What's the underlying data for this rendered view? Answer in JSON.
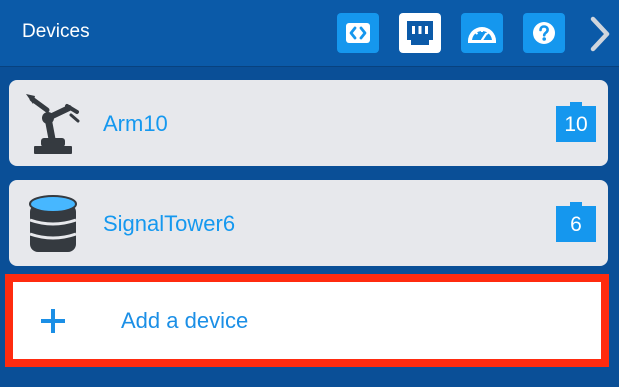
{
  "header": {
    "title": "Devices",
    "buttons": [
      {
        "name": "code-view-button",
        "icon": "code-icon"
      },
      {
        "name": "network-port-button",
        "icon": "ethernet-port-icon"
      },
      {
        "name": "dashboard-button",
        "icon": "speedometer-icon"
      },
      {
        "name": "help-button",
        "icon": "question-icon"
      }
    ],
    "next_icon": "chevron-right-icon"
  },
  "devices": [
    {
      "name": "Arm10",
      "icon": "robot-arm-icon",
      "badge_count": "10"
    },
    {
      "name": "SignalTower6",
      "icon": "signal-tower-icon",
      "badge_count": "6"
    }
  ],
  "add_device": {
    "label": "Add a device",
    "icon": "plus-icon"
  },
  "colors": {
    "background": "#0a4f97",
    "header": "#0b5aa8",
    "accent": "#1597ee",
    "card": "#e7e8ec",
    "highlight": "#ff2b0f",
    "text_link": "#1598ef"
  }
}
